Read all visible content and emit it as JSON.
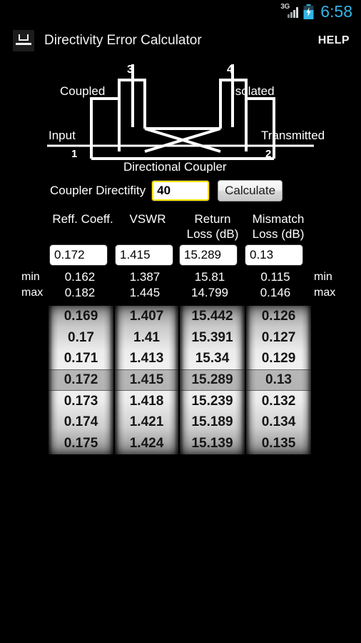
{
  "statusbar": {
    "network_label": "3G",
    "time": "6:58",
    "icons": [
      "signal-icon",
      "battery-charging-icon"
    ],
    "accent_color": "#33b5e5"
  },
  "actionbar": {
    "app_icon": "coupler-icon",
    "title": "Directivity Error Calculator",
    "help_label": "HELP"
  },
  "diagram": {
    "caption": "Directional Coupler",
    "labels": {
      "coupled": "Coupled",
      "isolated": "Isolated",
      "input": "Input",
      "transmitted": "Transmitted"
    },
    "ports": {
      "p1": "1",
      "p2": "2",
      "p3": "3",
      "p4": "4"
    }
  },
  "input_row": {
    "label": "Coupler Directifity",
    "value": "40",
    "placeholder": "40",
    "button_label": "Calculate",
    "field_border_color": "#ffe400"
  },
  "results": {
    "columns": [
      {
        "head_line1": "Reff. Coeff.",
        "head_line2": "",
        "value": "0.172",
        "min": "0.162",
        "max": "0.182"
      },
      {
        "head_line1": "VSWR",
        "head_line2": "",
        "value": "1.415",
        "min": "1.387",
        "max": "1.445"
      },
      {
        "head_line1": "Return",
        "head_line2": "Loss (dB)",
        "value": "15.289",
        "min": "15.81",
        "max": "14.799"
      },
      {
        "head_line1": "Mismatch",
        "head_line2": "Loss (dB)",
        "value": "0.13",
        "min": "0.115",
        "max": "0.146"
      }
    ],
    "min_label_left": "min",
    "max_label_left": "max",
    "min_label_right": "min",
    "max_label_right": "max"
  },
  "spinners": [
    {
      "name": "reflection-coefficient-wheel",
      "items": [
        "0.169",
        "0.17",
        "0.171",
        "0.172",
        "0.173",
        "0.174",
        "0.175"
      ],
      "selected_index": 3
    },
    {
      "name": "vswr-wheel",
      "items": [
        "1.407",
        "1.41",
        "1.413",
        "1.415",
        "1.418",
        "1.421",
        "1.424"
      ],
      "selected_index": 3
    },
    {
      "name": "return-loss-wheel",
      "items": [
        "15.442",
        "15.391",
        "15.34",
        "15.289",
        "15.239",
        "15.189",
        "15.139"
      ],
      "selected_index": 3
    },
    {
      "name": "mismatch-loss-wheel",
      "items": [
        "0.126",
        "0.127",
        "0.129",
        "0.13",
        "0.132",
        "0.134",
        "0.135"
      ],
      "selected_index": 3
    }
  ]
}
